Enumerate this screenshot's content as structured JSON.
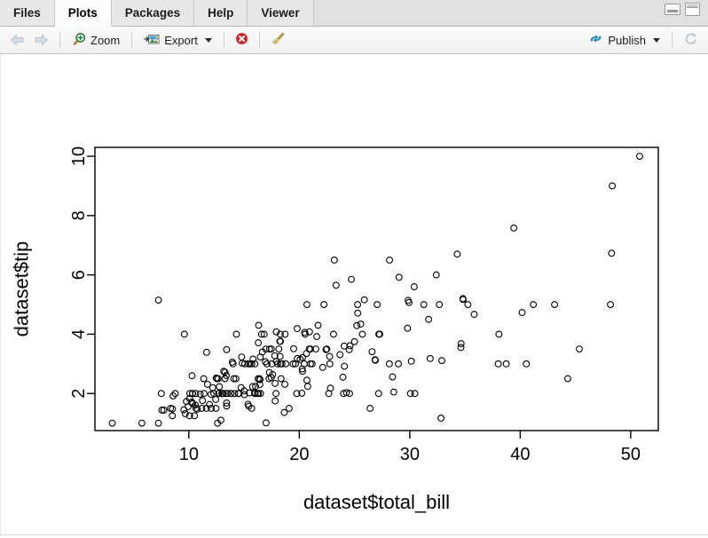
{
  "window": {
    "tabs": [
      {
        "label": "Files",
        "active": false
      },
      {
        "label": "Plots",
        "active": true
      },
      {
        "label": "Packages",
        "active": false
      },
      {
        "label": "Help",
        "active": false
      },
      {
        "label": "Viewer",
        "active": false
      }
    ],
    "minimize_icon": "minimize-pane-icon",
    "maximize_icon": "maximize-pane-icon"
  },
  "toolbar": {
    "back_icon": "left-arrow-icon",
    "forward_icon": "right-arrow-icon",
    "zoom_label": "Zoom",
    "zoom_icon": "magnifier-plus-icon",
    "export_label": "Export",
    "export_icon": "export-image-icon",
    "export_caret": "chevron-down-icon",
    "remove_icon": "remove-plot-icon",
    "clear_icon": "broom-clear-all-icon",
    "publish_label": "Publish",
    "publish_icon": "publish-icon",
    "publish_caret": "chevron-down-icon",
    "refresh_icon": "refresh-icon"
  },
  "chart_data": {
    "type": "scatter",
    "title": "",
    "xlabel": "dataset$total_bill",
    "ylabel": "dataset$tip",
    "xlim": [
      1.5,
      52.5
    ],
    "ylim": [
      0.75,
      10.3
    ],
    "xticks": [
      10,
      20,
      30,
      40,
      50
    ],
    "yticks": [
      2,
      4,
      6,
      8,
      10
    ],
    "grid": false,
    "legend": null,
    "marker": {
      "shape": "open-circle",
      "radius": 3.4,
      "stroke": "#000000",
      "fill": "none",
      "stroke_width": 1.1
    },
    "frame_color": "#000000",
    "n_points": 244,
    "points": [
      [
        16.99,
        1.01
      ],
      [
        10.34,
        1.66
      ],
      [
        21.01,
        3.5
      ],
      [
        23.68,
        3.31
      ],
      [
        24.59,
        3.61
      ],
      [
        25.29,
        4.71
      ],
      [
        8.77,
        2.0
      ],
      [
        26.88,
        3.12
      ],
      [
        15.04,
        1.96
      ],
      [
        14.78,
        3.23
      ],
      [
        10.27,
        1.71
      ],
      [
        35.26,
        5.0
      ],
      [
        15.42,
        1.57
      ],
      [
        18.43,
        3.0
      ],
      [
        14.83,
        3.02
      ],
      [
        21.58,
        3.92
      ],
      [
        10.33,
        1.67
      ],
      [
        16.29,
        3.71
      ],
      [
        16.97,
        3.5
      ],
      [
        20.65,
        3.35
      ],
      [
        17.92,
        4.08
      ],
      [
        20.29,
        2.75
      ],
      [
        15.77,
        2.23
      ],
      [
        39.42,
        7.58
      ],
      [
        19.82,
        3.18
      ],
      [
        17.81,
        2.34
      ],
      [
        13.37,
        2.0
      ],
      [
        12.69,
        2.0
      ],
      [
        21.7,
        4.3
      ],
      [
        19.65,
        3.0
      ],
      [
        9.55,
        1.45
      ],
      [
        18.35,
        2.5
      ],
      [
        15.06,
        3.0
      ],
      [
        20.69,
        2.45
      ],
      [
        17.78,
        3.27
      ],
      [
        24.06,
        3.6
      ],
      [
        16.31,
        2.0
      ],
      [
        16.93,
        3.07
      ],
      [
        18.69,
        2.31
      ],
      [
        31.27,
        5.0
      ],
      [
        16.04,
        2.24
      ],
      [
        17.46,
        2.54
      ],
      [
        13.94,
        3.06
      ],
      [
        9.68,
        1.32
      ],
      [
        30.4,
        5.6
      ],
      [
        18.29,
        3.0
      ],
      [
        22.23,
        5.0
      ],
      [
        32.4,
        6.0
      ],
      [
        28.55,
        2.05
      ],
      [
        18.04,
        3.0
      ],
      [
        12.54,
        2.5
      ],
      [
        10.29,
        2.6
      ],
      [
        34.81,
        5.2
      ],
      [
        9.94,
        1.56
      ],
      [
        25.56,
        4.34
      ],
      [
        19.49,
        3.51
      ],
      [
        38.01,
        3.0
      ],
      [
        26.41,
        1.5
      ],
      [
        11.24,
        1.76
      ],
      [
        48.27,
        6.73
      ],
      [
        20.29,
        3.21
      ],
      [
        13.81,
        2.0
      ],
      [
        11.02,
        1.98
      ],
      [
        18.29,
        3.76
      ],
      [
        17.59,
        2.64
      ],
      [
        20.08,
        3.15
      ],
      [
        16.45,
        2.47
      ],
      [
        3.07,
        1.0
      ],
      [
        20.23,
        2.01
      ],
      [
        15.01,
        2.09
      ],
      [
        12.02,
        1.97
      ],
      [
        17.07,
        3.0
      ],
      [
        26.86,
        3.14
      ],
      [
        25.28,
        5.0
      ],
      [
        14.73,
        2.2
      ],
      [
        10.51,
        1.25
      ],
      [
        17.92,
        3.08
      ],
      [
        27.2,
        4.0
      ],
      [
        22.76,
        3.0
      ],
      [
        17.29,
        2.71
      ],
      [
        19.44,
        3.0
      ],
      [
        16.66,
        3.4
      ],
      [
        10.07,
        1.83
      ],
      [
        32.68,
        5.0
      ],
      [
        15.98,
        2.03
      ],
      [
        34.83,
        5.17
      ],
      [
        13.03,
        2.0
      ],
      [
        18.28,
        4.0
      ],
      [
        24.71,
        5.85
      ],
      [
        21.16,
        3.0
      ],
      [
        28.97,
        3.0
      ],
      [
        22.49,
        3.5
      ],
      [
        5.75,
        1.0
      ],
      [
        16.32,
        4.3
      ],
      [
        22.75,
        3.25
      ],
      [
        40.17,
        4.73
      ],
      [
        27.28,
        4.0
      ],
      [
        12.03,
        1.5
      ],
      [
        21.01,
        3.0
      ],
      [
        12.46,
        1.5
      ],
      [
        11.35,
        2.5
      ],
      [
        15.38,
        3.0
      ],
      [
        44.3,
        2.5
      ],
      [
        22.42,
        3.48
      ],
      [
        20.92,
        4.08
      ],
      [
        15.36,
        1.64
      ],
      [
        20.49,
        4.06
      ],
      [
        25.21,
        4.29
      ],
      [
        18.24,
        3.76
      ],
      [
        14.31,
        4.0
      ],
      [
        14.0,
        3.0
      ],
      [
        7.25,
        1.0
      ],
      [
        38.07,
        4.0
      ],
      [
        23.95,
        2.55
      ],
      [
        25.71,
        4.0
      ],
      [
        17.31,
        3.5
      ],
      [
        29.93,
        5.07
      ],
      [
        10.65,
        1.5
      ],
      [
        12.43,
        1.8
      ],
      [
        24.08,
        2.92
      ],
      [
        11.69,
        2.31
      ],
      [
        13.42,
        1.68
      ],
      [
        14.26,
        2.5
      ],
      [
        15.95,
        2.0
      ],
      [
        12.48,
        2.52
      ],
      [
        29.8,
        4.2
      ],
      [
        8.52,
        1.48
      ],
      [
        14.52,
        2.0
      ],
      [
        11.38,
        2.0
      ],
      [
        22.82,
        2.18
      ],
      [
        19.08,
        1.5
      ],
      [
        20.27,
        2.83
      ],
      [
        11.17,
        1.5
      ],
      [
        12.26,
        2.0
      ],
      [
        18.26,
        3.25
      ],
      [
        8.51,
        1.25
      ],
      [
        10.33,
        2.0
      ],
      [
        14.15,
        2.0
      ],
      [
        16.0,
        2.0
      ],
      [
        13.16,
        2.75
      ],
      [
        17.47,
        3.5
      ],
      [
        34.3,
        6.7
      ],
      [
        41.19,
        5.0
      ],
      [
        27.05,
        5.0
      ],
      [
        16.43,
        2.3
      ],
      [
        8.35,
        1.5
      ],
      [
        18.64,
        1.36
      ],
      [
        11.87,
        1.63
      ],
      [
        9.78,
        1.73
      ],
      [
        7.51,
        2.0
      ],
      [
        14.07,
        2.5
      ],
      [
        13.13,
        2.0
      ],
      [
        17.26,
        2.5
      ],
      [
        24.55,
        2.0
      ],
      [
        19.77,
        2.0
      ],
      [
        29.85,
        5.14
      ],
      [
        48.17,
        5.0
      ],
      [
        25.0,
        3.75
      ],
      [
        13.39,
        2.61
      ],
      [
        16.49,
        2.0
      ],
      [
        21.5,
        3.5
      ],
      [
        12.66,
        2.5
      ],
      [
        16.21,
        2.0
      ],
      [
        13.81,
        2.0
      ],
      [
        17.51,
        3.0
      ],
      [
        24.52,
        3.48
      ],
      [
        20.76,
        2.24
      ],
      [
        31.71,
        4.5
      ],
      [
        10.59,
        1.61
      ],
      [
        10.63,
        2.0
      ],
      [
        50.81,
        10.0
      ],
      [
        15.81,
        3.16
      ],
      [
        7.25,
        5.15
      ],
      [
        31.85,
        3.18
      ],
      [
        16.82,
        4.0
      ],
      [
        32.9,
        3.11
      ],
      [
        17.89,
        2.0
      ],
      [
        14.48,
        2.0
      ],
      [
        9.6,
        4.0
      ],
      [
        34.63,
        3.55
      ],
      [
        34.65,
        3.68
      ],
      [
        23.33,
        5.65
      ],
      [
        45.35,
        3.5
      ],
      [
        23.17,
        6.5
      ],
      [
        40.55,
        3.0
      ],
      [
        20.69,
        5.0
      ],
      [
        20.9,
        3.5
      ],
      [
        30.46,
        2.0
      ],
      [
        18.15,
        3.5
      ],
      [
        23.1,
        4.0
      ],
      [
        15.69,
        1.5
      ],
      [
        19.81,
        4.19
      ],
      [
        28.44,
        2.56
      ],
      [
        15.48,
        2.02
      ],
      [
        16.58,
        4.0
      ],
      [
        7.56,
        1.44
      ],
      [
        10.34,
        2.0
      ],
      [
        43.11,
        5.0
      ],
      [
        13.0,
        2.0
      ],
      [
        13.51,
        2.0
      ],
      [
        18.71,
        4.0
      ],
      [
        12.74,
        2.01
      ],
      [
        13.0,
        2.0
      ],
      [
        16.4,
        2.5
      ],
      [
        20.53,
        4.0
      ],
      [
        16.47,
        3.23
      ],
      [
        26.59,
        3.41
      ],
      [
        38.73,
        3.0
      ],
      [
        24.27,
        2.03
      ],
      [
        12.76,
        2.23
      ],
      [
        30.06,
        2.0
      ],
      [
        25.89,
        5.16
      ],
      [
        48.33,
        9.0
      ],
      [
        13.27,
        2.5
      ],
      [
        28.17,
        6.5
      ],
      [
        12.9,
        1.1
      ],
      [
        28.15,
        3.0
      ],
      [
        11.59,
        1.5
      ],
      [
        7.74,
        1.44
      ],
      [
        30.14,
        3.09
      ],
      [
        12.16,
        2.2
      ],
      [
        13.42,
        3.48
      ],
      [
        8.58,
        1.92
      ],
      [
        15.98,
        3.0
      ],
      [
        13.42,
        1.58
      ],
      [
        16.27,
        2.5
      ],
      [
        10.09,
        2.0
      ],
      [
        20.45,
        3.0
      ],
      [
        13.28,
        2.72
      ],
      [
        22.12,
        2.88
      ],
      [
        24.01,
        2.0
      ],
      [
        15.69,
        3.0
      ],
      [
        11.61,
        3.39
      ],
      [
        10.77,
        1.47
      ],
      [
        15.53,
        3.0
      ],
      [
        10.07,
        1.25
      ],
      [
        12.6,
        1.0
      ],
      [
        32.83,
        1.17
      ],
      [
        35.83,
        4.67
      ],
      [
        29.03,
        5.92
      ],
      [
        27.18,
        2.0
      ],
      [
        22.67,
        2.0
      ],
      [
        17.82,
        1.75
      ],
      [
        18.78,
        3.0
      ]
    ]
  }
}
